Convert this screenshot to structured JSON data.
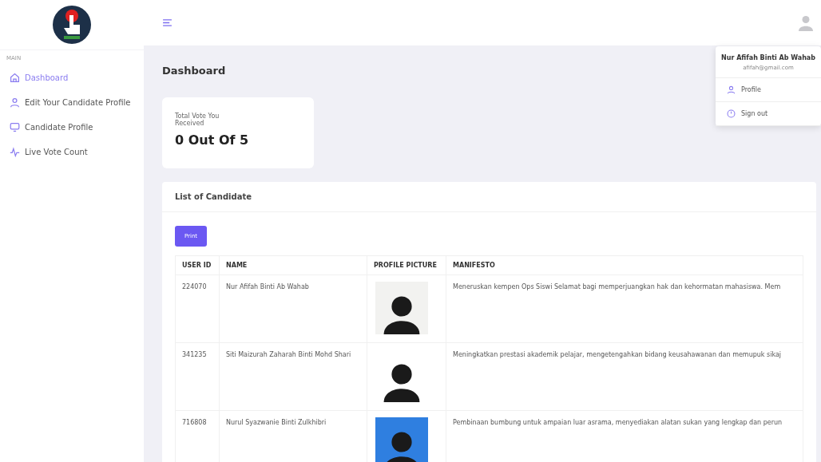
{
  "sidebar": {
    "section": "MAIN",
    "items": [
      {
        "label": "Dashboard",
        "selected": true
      },
      {
        "label": "Edit Your Candidate Profile",
        "selected": false
      },
      {
        "label": "Candidate Profile",
        "selected": false
      },
      {
        "label": "Live Vote Count",
        "selected": false
      }
    ]
  },
  "page_title": "Dashboard",
  "stat_card": {
    "label": "Total Vote You Received",
    "value": "0 Out Of 5"
  },
  "candidates": {
    "title": "List of Candidate",
    "print_button": "Print",
    "columns": [
      "USER ID",
      "NAME",
      "PROFILE PICTURE",
      "MANIFESTO"
    ],
    "rows": [
      {
        "user_id": "224070",
        "name": "Nur Afifah Binti Ab Wahab",
        "manifesto": "Meneruskan kempen Ops Siswi Selamat bagi memperjuangkan hak dan kehormatan mahasiswa. Mem"
      },
      {
        "user_id": "341235",
        "name": "Siti Maizurah Zaharah Binti Mohd Shari",
        "manifesto": "Meningkatkan prestasi akademik pelajar, mengetengahkan bidang keusahawanan dan memupuk sikaj"
      },
      {
        "user_id": "716808",
        "name": "Nurul Syazwanie Binti Zulkhibri",
        "manifesto": "Pembinaan bumbung untuk ampaian luar asrama, menyediakan alatan sukan yang lengkap dan perun"
      }
    ]
  },
  "user_menu": {
    "name": "Nur Afifah Binti Ab Wahab",
    "email": "afifah@gmail.com",
    "items": [
      {
        "label": "Profile"
      },
      {
        "label": "Sign out"
      }
    ]
  }
}
